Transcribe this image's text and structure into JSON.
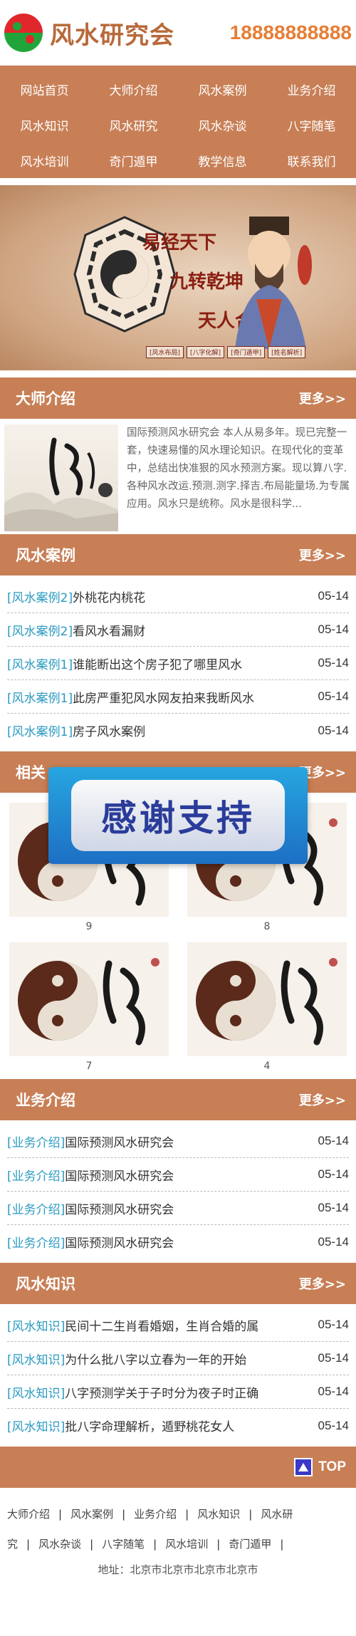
{
  "header": {
    "site_name": "风水研究会",
    "phone": "18888888888"
  },
  "nav": [
    "网站首页",
    "大师介绍",
    "风水案例",
    "业务介绍",
    "风水知识",
    "风水研究",
    "风水杂谈",
    "八字随笔",
    "风水培训",
    "奇门遁甲",
    "教学信息",
    "联系我们"
  ],
  "banner": {
    "line1": "易经天下",
    "line2": "九转乾坤",
    "line3": "天人合一",
    "tags": [
      "[风水布局]",
      "[八字化解]",
      "[奇门遁甲]",
      "[姓名解析]"
    ]
  },
  "master": {
    "title": "大师介绍",
    "more": "更多>>",
    "text": "国际预测风水研究会 本人从易多年。现已完整一套，快速易懂的风水理论知识。在现代化的变革中，总结出快准狠的风水预测方案。现以算八字.各种风水改运.预测.测字.择吉.布局能量场.为专属应用。风水只是统称。风水是很科学..."
  },
  "cases": {
    "title": "风水案例",
    "more": "更多>>",
    "items": [
      {
        "tag": "[风水案例2]",
        "title": "外桃花内桃花",
        "date": "05-14"
      },
      {
        "tag": "[风水案例2]",
        "title": "看风水看漏财",
        "date": "05-14"
      },
      {
        "tag": "[风水案例1]",
        "title": "谁能断出这个房子犯了哪里风水",
        "date": "05-14"
      },
      {
        "tag": "[风水案例1]",
        "title": "此房严重犯风水网友拍来我断风水",
        "date": "05-14"
      },
      {
        "tag": "[风水案例1]",
        "title": "房子风水案例",
        "date": "05-14"
      }
    ]
  },
  "related": {
    "title": "相关",
    "more": "更多>>",
    "items": [
      {
        "caption": "9"
      },
      {
        "caption": "8"
      },
      {
        "caption": "7"
      },
      {
        "caption": "4"
      }
    ]
  },
  "popup": {
    "text": "感谢支持"
  },
  "business": {
    "title": "业务介绍",
    "more": "更多>>",
    "items": [
      {
        "tag": "[业务介绍]",
        "title": "国际预测风水研究会",
        "date": "05-14"
      },
      {
        "tag": "[业务介绍]",
        "title": "国际预测风水研究会",
        "date": "05-14"
      },
      {
        "tag": "[业务介绍]",
        "title": "国际预测风水研究会",
        "date": "05-14"
      },
      {
        "tag": "[业务介绍]",
        "title": "国际预测风水研究会",
        "date": "05-14"
      }
    ]
  },
  "knowledge": {
    "title": "风水知识",
    "more": "更多>>",
    "items": [
      {
        "tag": "[风水知识]",
        "title": "民间十二生肖看婚姻，生肖合婚的属",
        "date": "05-14"
      },
      {
        "tag": "[风水知识]",
        "title": "为什么批八字以立春为一年的开始",
        "date": "05-14"
      },
      {
        "tag": "[风水知识]",
        "title": "八字预测学关于子时分为夜子时正确",
        "date": "05-14"
      },
      {
        "tag": "[风水知识]",
        "title": "批八字命理解析，遁野桃花女人",
        "date": "05-14"
      }
    ]
  },
  "footer": {
    "top_label": "TOP",
    "links_row1": [
      "大师介绍",
      "风水案例",
      "业务介绍",
      "风水知识",
      "风水研"
    ],
    "links_row2": [
      "究",
      "风水杂谈",
      "八字随笔",
      "风水培训",
      "奇门遁甲",
      ""
    ],
    "address": "地址：北京市北京市北京市北京市"
  },
  "colors": {
    "accent": "#c87f56",
    "phone": "#e67e35",
    "tag": "#2a9ac1"
  }
}
